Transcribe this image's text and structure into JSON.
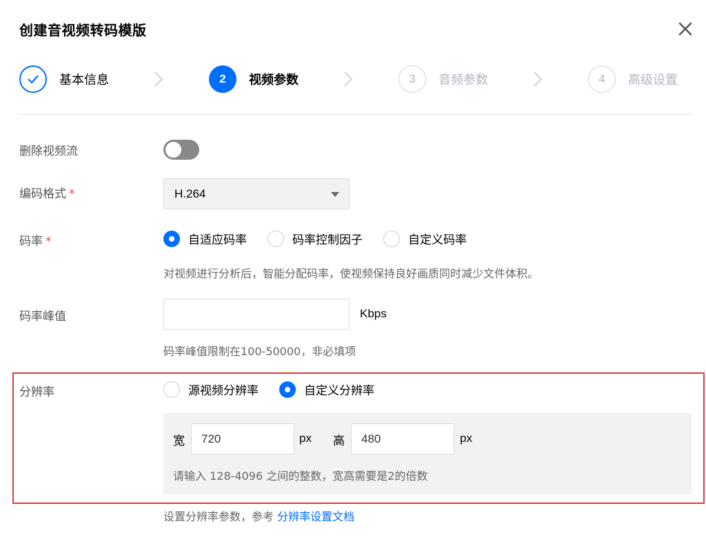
{
  "dialog": {
    "title": "创建音视频转码模版"
  },
  "steps": [
    {
      "number": "1",
      "label": "基本信息",
      "state": "done"
    },
    {
      "number": "2",
      "label": "视频参数",
      "state": "active"
    },
    {
      "number": "3",
      "label": "音频参数",
      "state": "todo"
    },
    {
      "number": "4",
      "label": "高级设置",
      "state": "todo"
    }
  ],
  "form": {
    "delete_video_stream": {
      "label": "删除视频流",
      "enabled": false
    },
    "codec": {
      "label": "编码格式",
      "required_mark": "*",
      "value": "H.264"
    },
    "bitrate": {
      "label": "码率",
      "required_mark": "*",
      "options": [
        "自适应码率",
        "码率控制因子",
        "自定义码率"
      ],
      "selected": "自适应码率",
      "hint": "对视频进行分析后，智能分配码率，使视频保持良好画质同时减少文件体积。"
    },
    "peak_bitrate": {
      "label": "码率峰值",
      "value": "",
      "unit": "Kbps",
      "hint": "码率峰值限制在100-50000，非必填项"
    },
    "resolution": {
      "label": "分辨率",
      "options": [
        "源视频分辨率",
        "自定义分辨率"
      ],
      "selected": "自定义分辨率",
      "width_label": "宽",
      "width_value": "720",
      "width_unit": "px",
      "height_label": "高",
      "height_value": "480",
      "height_unit": "px",
      "hint": "请输入 128-4096 之间的整数，宽高需要是2的倍数",
      "doc_prefix": "设置分辨率参数，参考",
      "doc_link": "分辨率设置文档"
    }
  },
  "colors": {
    "accent": "#006eff",
    "highlight": "#e03a3a",
    "required": "#e54545"
  },
  "icons": {
    "close": "close-icon",
    "step_done": "check-icon",
    "step_separator": "chevron-right-icon",
    "select_caret": "caret-down-icon"
  }
}
